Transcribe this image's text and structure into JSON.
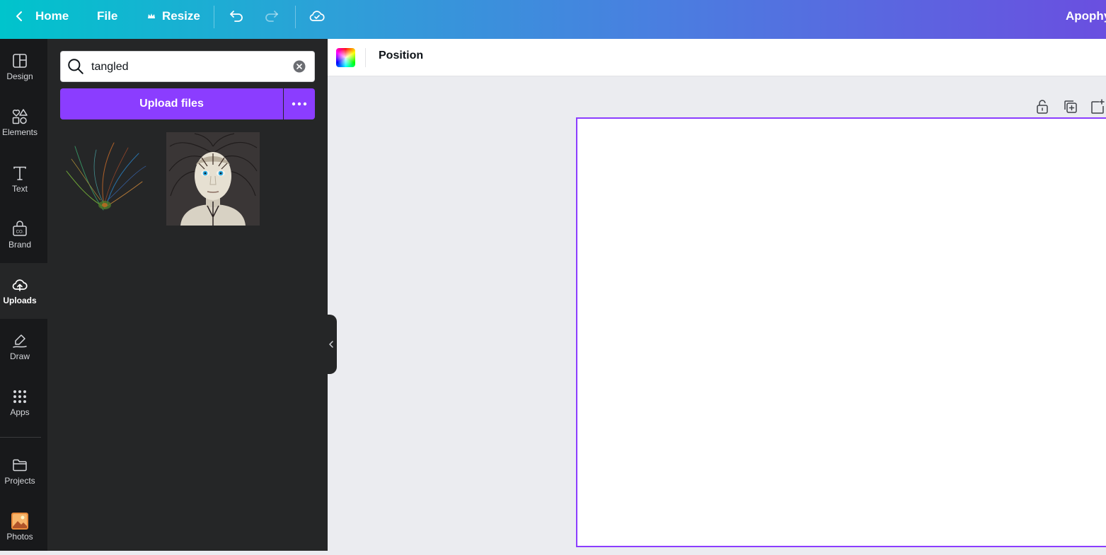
{
  "topbar": {
    "home_label": "Home",
    "file_label": "File",
    "resize_label": "Resize",
    "user_name": "Apophy"
  },
  "rail": {
    "items": [
      {
        "label": "Design",
        "icon": "layout-icon"
      },
      {
        "label": "Elements",
        "icon": "shapes-icon"
      },
      {
        "label": "Text",
        "icon": "text-t-icon"
      },
      {
        "label": "Brand",
        "icon": "brand-kit-icon"
      },
      {
        "label": "Uploads",
        "icon": "cloud-upload-icon",
        "active": true
      },
      {
        "label": "Draw",
        "icon": "pen-icon"
      },
      {
        "label": "Apps",
        "icon": "grid-icon"
      },
      {
        "label": "Projects",
        "icon": "folder-icon"
      },
      {
        "label": "Photos",
        "icon": "photo-icon"
      }
    ]
  },
  "panel": {
    "search_value": "tangled",
    "upload_label": "Upload files"
  },
  "context": {
    "position_label": "Position"
  },
  "colors": {
    "accent": "#8b3dff",
    "rail_bg": "#18191b",
    "panel_bg": "#252627",
    "canvas_bg": "#ebecf0"
  }
}
